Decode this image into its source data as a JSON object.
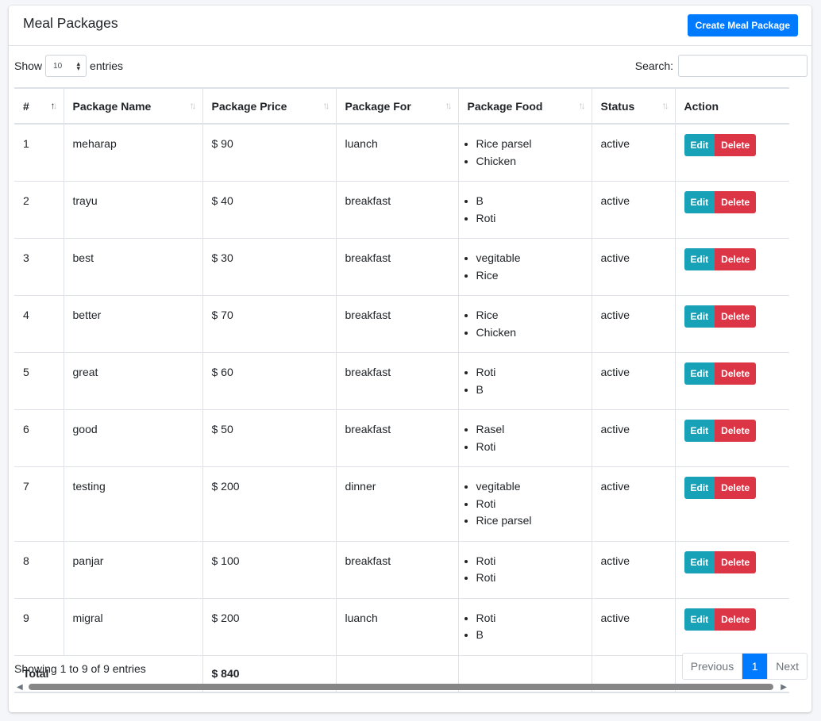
{
  "header": {
    "title": "Meal Packages",
    "create_label": "Create Meal Package"
  },
  "length": {
    "show": "Show",
    "value": "10",
    "entries": "entries"
  },
  "search": {
    "label": "Search:",
    "value": ""
  },
  "columns": [
    "#",
    "Package Name",
    "Package Price",
    "Package For",
    "Package Food",
    "Status",
    "Action"
  ],
  "rows": [
    {
      "num": "1",
      "name": "meharap",
      "price": "$ 90",
      "for": "luanch",
      "food": [
        "Rice parsel",
        "Chicken"
      ],
      "status": "active"
    },
    {
      "num": "2",
      "name": "trayu",
      "price": "$ 40",
      "for": "breakfast",
      "food": [
        "B",
        "Roti"
      ],
      "status": "active"
    },
    {
      "num": "3",
      "name": "best",
      "price": "$ 30",
      "for": "breakfast",
      "food": [
        "vegitable",
        "Rice"
      ],
      "status": "active"
    },
    {
      "num": "4",
      "name": "better",
      "price": "$ 70",
      "for": "breakfast",
      "food": [
        "Rice",
        "Chicken"
      ],
      "status": "active"
    },
    {
      "num": "5",
      "name": "great",
      "price": "$ 60",
      "for": "breakfast",
      "food": [
        "Roti",
        "B"
      ],
      "status": "active"
    },
    {
      "num": "6",
      "name": "good",
      "price": "$ 50",
      "for": "breakfast",
      "food": [
        "Rasel",
        "Roti"
      ],
      "status": "active"
    },
    {
      "num": "7",
      "name": "testing",
      "price": "$ 200",
      "for": "dinner",
      "food": [
        "vegitable",
        "Roti",
        "Rice parsel"
      ],
      "status": "active"
    },
    {
      "num": "8",
      "name": "panjar",
      "price": "$ 100",
      "for": "breakfast",
      "food": [
        "Roti",
        "Roti"
      ],
      "status": "active"
    },
    {
      "num": "9",
      "name": "migral",
      "price": "$ 200",
      "for": "luanch",
      "food": [
        "Roti",
        "B"
      ],
      "status": "active"
    }
  ],
  "actions": {
    "edit": "Edit",
    "delete": "Delete"
  },
  "total": {
    "label": "Total",
    "value": "$ 840"
  },
  "info": "Showing 1 to 9 of 9 entries",
  "pagination": {
    "previous": "Previous",
    "current": "1",
    "next": "Next"
  },
  "colors": {
    "primary": "#007bff",
    "info": "#17a2b8",
    "danger": "#dc3545"
  }
}
